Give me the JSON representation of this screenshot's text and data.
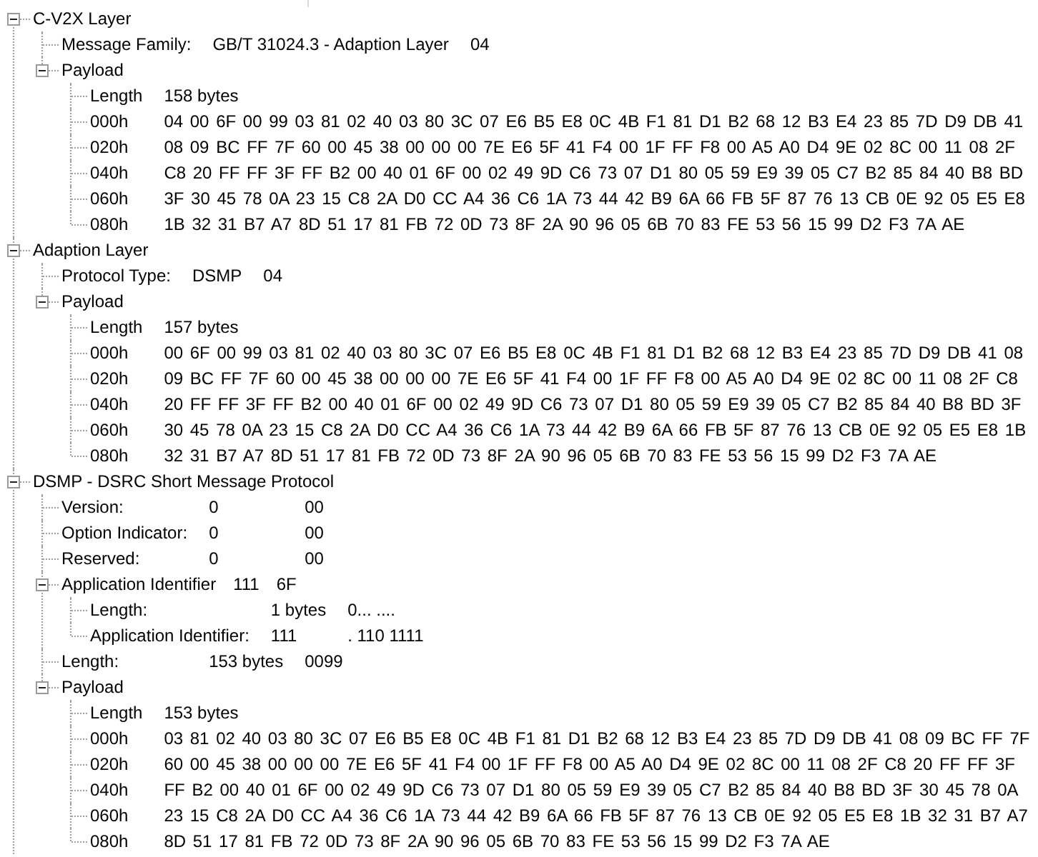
{
  "tree": [
    {
      "kind": "group",
      "label": "C-V2X Layer",
      "expanded": true,
      "children": [
        {
          "kind": "field",
          "label": "Message Family:",
          "values": [
            "GB/T 31024.3 - Adaption Layer",
            "04"
          ]
        },
        {
          "kind": "group",
          "label": "Payload",
          "expanded": true,
          "children": [
            {
              "kind": "field",
              "label": "Length",
              "values": [
                "158 bytes"
              ]
            },
            {
              "kind": "hex",
              "label": "000h",
              "bytes": "04 00 6F 00 99 03 81 02 40 03 80 3C 07 E6 B5 E8 0C 4B F1 81 D1 B2 68 12 B3 E4 23 85 7D D9 DB 41"
            },
            {
              "kind": "hex",
              "label": "020h",
              "bytes": "08 09 BC FF 7F 60 00 45 38 00 00 00 7E E6 5F 41 F4 00 1F FF F8 00 A5 A0 D4 9E 02 8C 00 11 08 2F"
            },
            {
              "kind": "hex",
              "label": "040h",
              "bytes": "C8 20 FF FF 3F FF B2 00 40 01 6F 00 02 49 9D C6 73 07 D1 80 05 59 E9 39 05 C7 B2 85 84 40 B8 BD"
            },
            {
              "kind": "hex",
              "label": "060h",
              "bytes": "3F 30 45 78 0A 23 15 C8 2A D0 CC A4 36 C6 1A 73 44 42 B9 6A 66 FB 5F 87 76 13 CB 0E 92 05 E5 E8"
            },
            {
              "kind": "hex",
              "label": "080h",
              "bytes": "1B 32 31 B7 A7 8D 51 17 81 FB 72 0D 73 8F 2A 90 96 05 6B 70 83 FE 53 56 15 99 D2 F3 7A AE"
            }
          ]
        }
      ]
    },
    {
      "kind": "group",
      "label": "Adaption Layer",
      "expanded": true,
      "children": [
        {
          "kind": "field",
          "label": "Protocol Type:",
          "values": [
            "DSMP",
            "04"
          ]
        },
        {
          "kind": "group",
          "label": "Payload",
          "expanded": true,
          "children": [
            {
              "kind": "field",
              "label": "Length",
              "values": [
                "157 bytes"
              ]
            },
            {
              "kind": "hex",
              "label": "000h",
              "bytes": "00 6F 00 99 03 81 02 40 03 80 3C 07 E6 B5 E8 0C 4B F1 81 D1 B2 68 12 B3 E4 23 85 7D D9 DB 41 08"
            },
            {
              "kind": "hex",
              "label": "020h",
              "bytes": "09 BC FF 7F 60 00 45 38 00 00 00 7E E6 5F 41 F4 00 1F FF F8 00 A5 A0 D4 9E 02 8C 00 11 08 2F C8"
            },
            {
              "kind": "hex",
              "label": "040h",
              "bytes": "20 FF FF 3F FF B2 00 40 01 6F 00 02 49 9D C6 73 07 D1 80 05 59 E9 39 05 C7 B2 85 84 40 B8 BD 3F"
            },
            {
              "kind": "hex",
              "label": "060h",
              "bytes": "30 45 78 0A 23 15 C8 2A D0 CC A4 36 C6 1A 73 44 42 B9 6A 66 FB 5F 87 76 13 CB 0E 92 05 E5 E8 1B"
            },
            {
              "kind": "hex",
              "label": "080h",
              "bytes": "32 31 B7 A7 8D 51 17 81 FB 72 0D 73 8F 2A 90 96 05 6B 70 83 FE 53 56 15 99 D2 F3 7A AE"
            }
          ]
        }
      ]
    },
    {
      "kind": "group",
      "label": "DSMP - DSRC Short Message Protocol",
      "expanded": true,
      "children": [
        {
          "kind": "field",
          "label": "Version:",
          "values": [
            "0",
            "00"
          ]
        },
        {
          "kind": "field",
          "label": "Option Indicator:",
          "values": [
            "0",
            "00"
          ]
        },
        {
          "kind": "field",
          "label": "Reserved:",
          "values": [
            "0",
            "00"
          ]
        },
        {
          "kind": "group",
          "label": "Application Identifier",
          "values": [
            "111",
            "6F"
          ],
          "expanded": true,
          "children": [
            {
              "kind": "field",
              "label": "Length:",
              "values": [
                "1 bytes",
                "0... ...."
              ]
            },
            {
              "kind": "field",
              "label": "Application Identifier:",
              "values": [
                "111",
                ". 110 1111"
              ]
            }
          ]
        },
        {
          "kind": "field",
          "label": "Length:",
          "values": [
            "153 bytes",
            "0099"
          ]
        },
        {
          "kind": "group",
          "label": "Payload",
          "expanded": true,
          "children": [
            {
              "kind": "field",
              "label": "Length",
              "values": [
                "153 bytes"
              ]
            },
            {
              "kind": "hex",
              "label": "000h",
              "bytes": "03 81 02 40 03 80 3C 07 E6 B5 E8 0C 4B F1 81 D1 B2 68 12 B3 E4 23 85 7D D9 DB 41 08 09 BC FF 7F"
            },
            {
              "kind": "hex",
              "label": "020h",
              "bytes": "60 00 45 38 00 00 00 7E E6 5F 41 F4 00 1F FF F8 00 A5 A0 D4 9E 02 8C 00 11 08 2F C8 20 FF FF 3F"
            },
            {
              "kind": "hex",
              "label": "040h",
              "bytes": "FF B2 00 40 01 6F 00 02 49 9D C6 73 07 D1 80 05 59 E9 39 05 C7 B2 85 84 40 B8 BD 3F 30 45 78 0A"
            },
            {
              "kind": "hex",
              "label": "060h",
              "bytes": "23 15 C8 2A D0 CC A4 36 C6 1A 73 44 42 B9 6A 66 FB 5F 87 76 13 CB 0E 92 05 E5 E8 1B 32 31 B7 A7"
            },
            {
              "kind": "hex",
              "label": "080h",
              "bytes": "8D 51 17 81 FB 72 0D 73 8F 2A 90 96 05 6B 70 83 FE 53 56 15 99 D2 F3 7A AE"
            }
          ]
        }
      ]
    }
  ]
}
